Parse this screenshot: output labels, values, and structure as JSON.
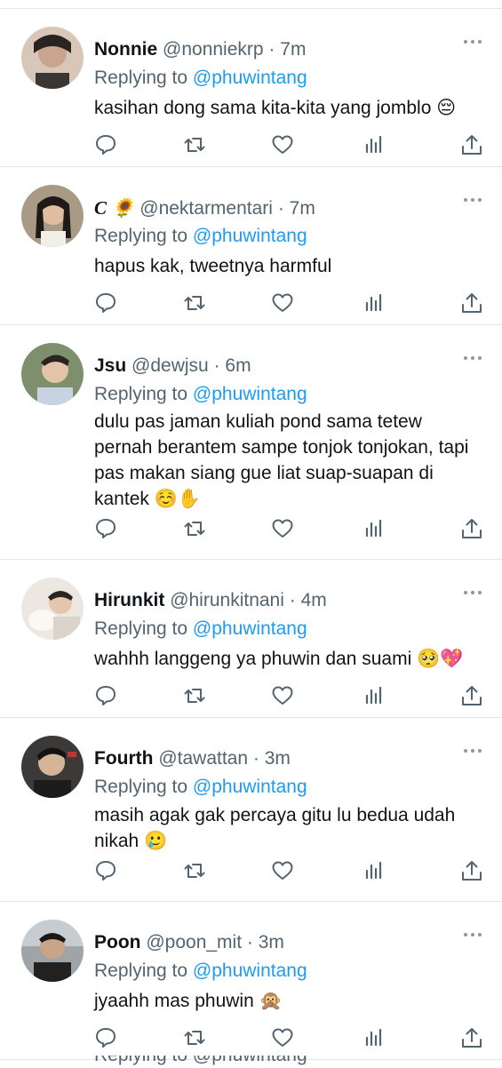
{
  "reply_prefix": "Replying to",
  "tweets": [
    {
      "name": "Nonnie",
      "handle": "@nonniekrp",
      "dot": "·",
      "time": "7m",
      "mention": "@phuwintang",
      "text": "kasihan dong sama kita-kita yang jomblo 😔",
      "avatar_color": "#c9a48e"
    },
    {
      "name": "C 🌻",
      "handle": "@nektarmentari",
      "dot": "·",
      "time": "7m",
      "mention": "@phuwintang",
      "text": "hapus kak, tweetnya harmful",
      "avatar_color": "#b89a7a"
    },
    {
      "name": "Jsu",
      "handle": "@dewjsu",
      "dot": "·",
      "time": "6m",
      "mention": "@phuwintang",
      "text": "dulu pas jaman kuliah pond sama tetew pernah berantem sampe tonjok tonjokan, tapi pas makan siang gue liat suap-suapan di kantek ☺️✋",
      "avatar_color": "#8a9a7c"
    },
    {
      "name": "Hirunkit",
      "handle": "@hirunkitnani",
      "dot": "·",
      "time": "4m",
      "mention": "@phuwintang",
      "text": "wahhh langgeng ya phuwin dan suami 🥺💖",
      "avatar_color": "#d9d1c6"
    },
    {
      "name": "Fourth",
      "handle": "@tawattan",
      "dot": "·",
      "time": "3m",
      "mention": "@phuwintang",
      "text": "masih agak gak percaya gitu lu bedua udah nikah 🥲",
      "avatar_color": "#4b4a48"
    },
    {
      "name": "Poon",
      "handle": "@poon_mit",
      "dot": "·",
      "time": "3m",
      "mention": "@phuwintang",
      "text": "jyaahh mas phuwin 🙊",
      "avatar_color": "#6f6a66"
    }
  ],
  "cutoff_text": "Replying to @phuwintang",
  "colors": {
    "text": "#0f1419",
    "secondary": "#536471",
    "link": "#1d9bf0",
    "divider": "#e1e6ea"
  },
  "icons": [
    "reply-icon",
    "retweet-icon",
    "like-icon",
    "analytics-icon",
    "share-icon",
    "more-icon"
  ]
}
